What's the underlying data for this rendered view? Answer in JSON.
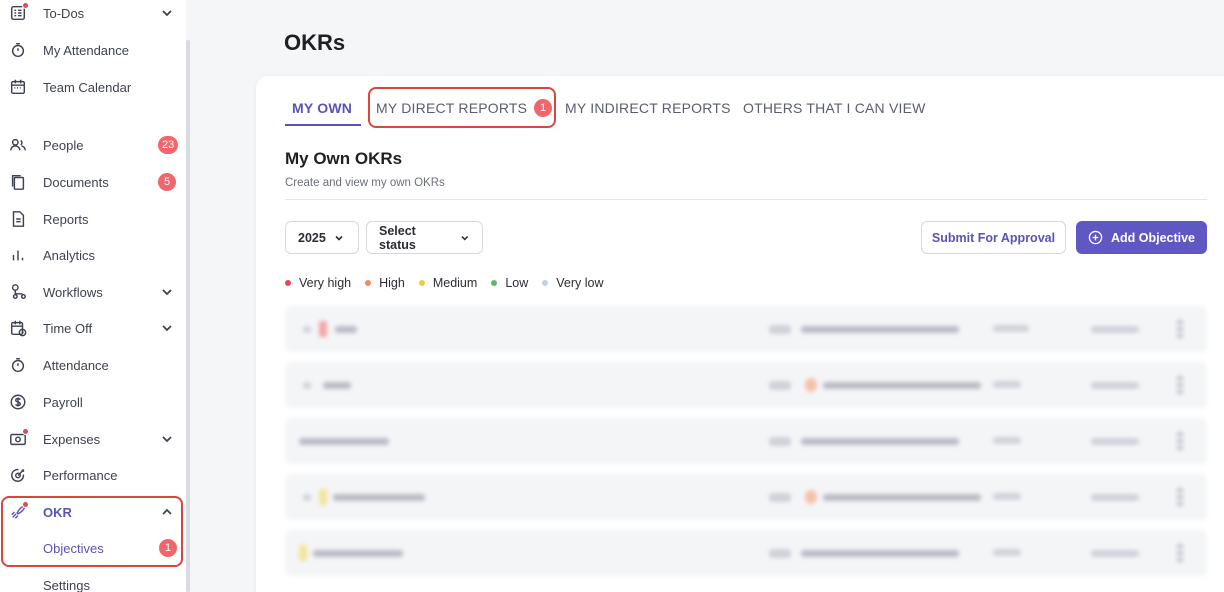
{
  "sidebar": {
    "items": [
      {
        "label": "To-Dos",
        "icon": "checklist-icon",
        "badge": "",
        "chevron": "down",
        "dot": true
      },
      {
        "label": "My Attendance",
        "icon": "stopwatch-icon",
        "badge": "",
        "chevron": "",
        "dot": false
      },
      {
        "label": "Team Calendar",
        "icon": "calendar-icon",
        "badge": "",
        "chevron": "",
        "dot": false
      },
      {
        "label": "People",
        "icon": "people-icon",
        "badge": "23",
        "chevron": "",
        "dot": false
      },
      {
        "label": "Documents",
        "icon": "documents-icon",
        "badge": "5",
        "chevron": "",
        "dot": false
      },
      {
        "label": "Reports",
        "icon": "report-icon",
        "badge": "",
        "chevron": "",
        "dot": false
      },
      {
        "label": "Analytics",
        "icon": "bar-chart-icon",
        "badge": "",
        "chevron": "",
        "dot": false
      },
      {
        "label": "Workflows",
        "icon": "workflow-icon",
        "badge": "",
        "chevron": "down",
        "dot": false
      },
      {
        "label": "Time Off",
        "icon": "calendar-clock-icon",
        "badge": "",
        "chevron": "down",
        "dot": false
      },
      {
        "label": "Attendance",
        "icon": "stopwatch-icon",
        "badge": "",
        "chevron": "",
        "dot": false
      },
      {
        "label": "Payroll",
        "icon": "dollar-icon",
        "badge": "",
        "chevron": "",
        "dot": false
      },
      {
        "label": "Expenses",
        "icon": "money-icon",
        "badge": "",
        "chevron": "down",
        "dot": true
      },
      {
        "label": "Performance",
        "icon": "target-icon",
        "badge": "",
        "chevron": "",
        "dot": false
      },
      {
        "label": "OKR",
        "icon": "rocket-icon",
        "badge": "",
        "chevron": "up",
        "dot": true
      },
      {
        "label": "Objectives",
        "icon": "",
        "badge": "1",
        "chevron": "",
        "dot": false
      },
      {
        "label": "Settings",
        "icon": "",
        "badge": "",
        "chevron": "",
        "dot": false
      }
    ]
  },
  "page": {
    "title": "OKRs"
  },
  "tabs": [
    {
      "label": "MY OWN",
      "badge": ""
    },
    {
      "label": "MY DIRECT REPORTS",
      "badge": "1"
    },
    {
      "label": "MY INDIRECT REPORTS",
      "badge": ""
    },
    {
      "label": "OTHERS THAT I CAN VIEW",
      "badge": ""
    }
  ],
  "section": {
    "title": "My Own OKRs",
    "subtitle": "Create and view my own OKRs"
  },
  "filters": {
    "year": "2025",
    "status_placeholder": "Select status"
  },
  "actions": {
    "submit": "Submit For Approval",
    "add": "Add Objective"
  },
  "legend": [
    {
      "label": "Very high",
      "color": "#e5484d"
    },
    {
      "label": "High",
      "color": "#f08a5d"
    },
    {
      "label": "Medium",
      "color": "#f0c94a"
    },
    {
      "label": "Low",
      "color": "#5fb76b"
    },
    {
      "label": "Very low",
      "color": "#b9d3ee"
    }
  ],
  "colors": {
    "accent": "#5b52b8",
    "primary_button": "#6058c2",
    "badge": "#f0666c",
    "highlight": "#d8463f"
  }
}
